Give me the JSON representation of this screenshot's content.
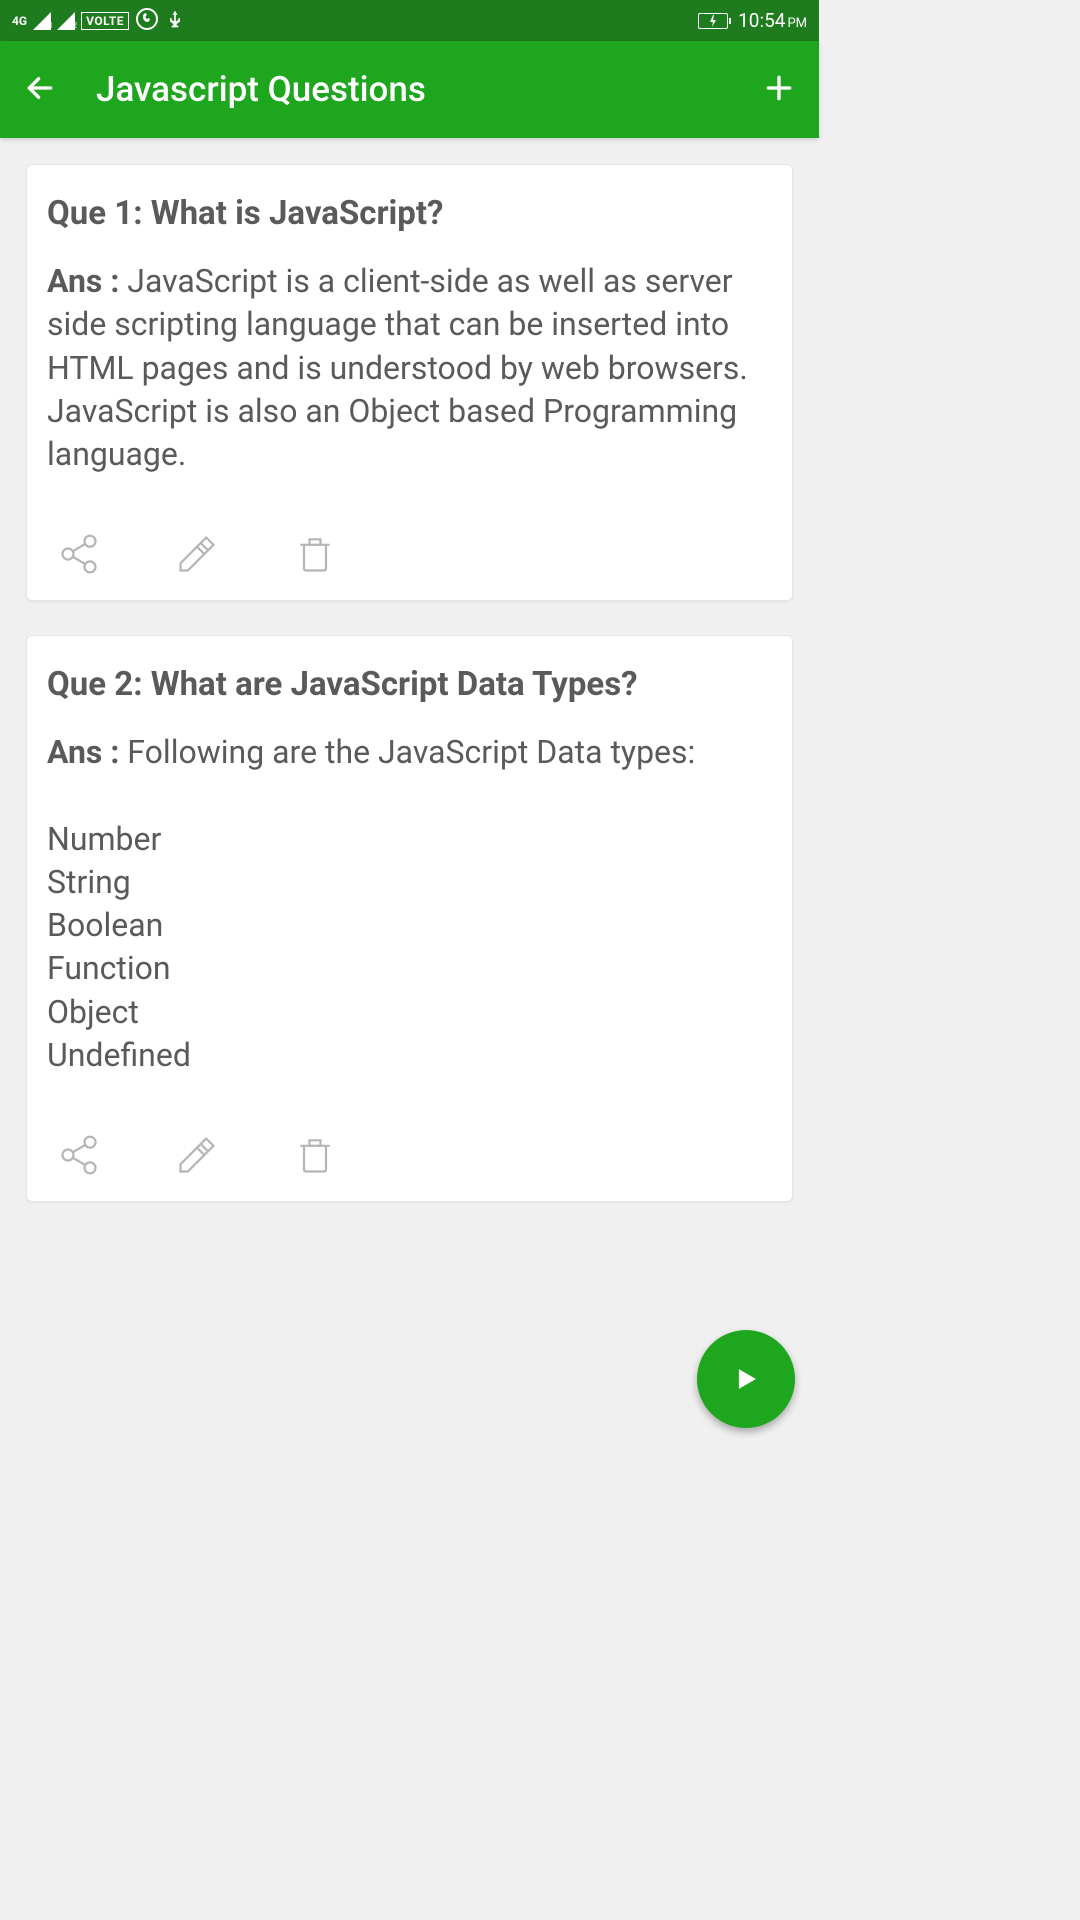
{
  "status_bar": {
    "network_type": "4G",
    "volte": "VOLTE",
    "time": "10:54",
    "ampm": "PM"
  },
  "app_bar": {
    "title": "Javascript Questions"
  },
  "questions": [
    {
      "title": "Que 1: What is JavaScript?",
      "ans_label": "Ans : ",
      "ans_text": "JavaScript is a client-side as well as server side scripting language that can be inserted into HTML pages and is understood by web browsers. JavaScript is also an Object based Programming language."
    },
    {
      "title": "Que 2: What are JavaScript Data Types?",
      "ans_label": "Ans : ",
      "ans_text": "Following are the JavaScript Data types:",
      "list": [
        "Number",
        "String",
        "Boolean",
        "Function",
        "Object",
        "Undefined"
      ]
    }
  ]
}
